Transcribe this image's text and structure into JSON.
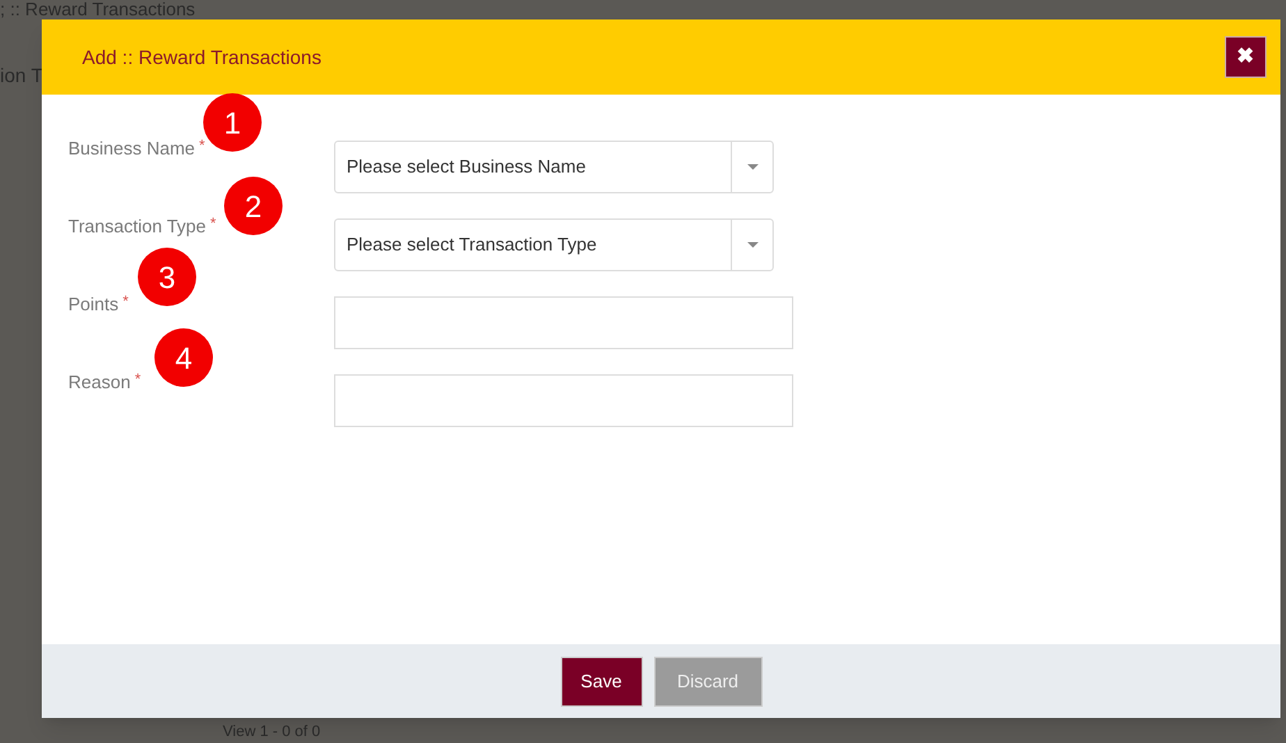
{
  "background": {
    "page_title": "; :: Reward Transactions",
    "column_fragment": "ion T",
    "pager_text": "View 1 - 0 of 0"
  },
  "dialog": {
    "title": "Add :: Reward Transactions",
    "close_icon": "✖",
    "fields": [
      {
        "kind": "select",
        "label": "Business Name",
        "required_mark": "*",
        "placeholder": "Please select Business Name"
      },
      {
        "kind": "select",
        "label": "Transaction Type",
        "required_mark": "*",
        "placeholder": "Please select Transaction Type"
      },
      {
        "kind": "text",
        "label": "Points",
        "required_mark": "*"
      },
      {
        "kind": "text",
        "label": "Reason",
        "required_mark": "*"
      }
    ],
    "buttons": [
      {
        "label": "Save",
        "kind": "primary"
      },
      {
        "label": "Discard",
        "kind": "secondary"
      }
    ]
  },
  "annotations": [
    "1",
    "2",
    "3",
    "4"
  ]
}
